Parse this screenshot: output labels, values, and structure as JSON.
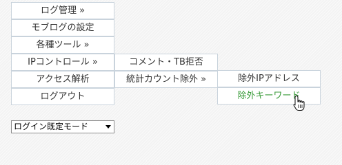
{
  "menu": {
    "items": [
      {
        "label": "ログ管理 »"
      },
      {
        "label": "モブログの設定"
      },
      {
        "label": "各種ツール »"
      },
      {
        "label": "IPコントロール »"
      },
      {
        "label": "アクセス解析"
      },
      {
        "label": "ログアウト"
      }
    ]
  },
  "submenu_ip": {
    "items": [
      {
        "label": "コメント・TB拒否"
      },
      {
        "label": "統計カウント除外 »"
      }
    ]
  },
  "submenu_exclude": {
    "items": [
      {
        "label": "除外IPアドレス"
      },
      {
        "label": "除外キーワード"
      }
    ]
  },
  "login_select": {
    "value": "ログイン既定モード"
  },
  "colors": {
    "hover_text": "#3a9b3a",
    "menu_border": "#c9d3dc"
  },
  "icons": {
    "cursor": "hand-pointer-icon",
    "dropdown": "triangle-down-icon"
  }
}
